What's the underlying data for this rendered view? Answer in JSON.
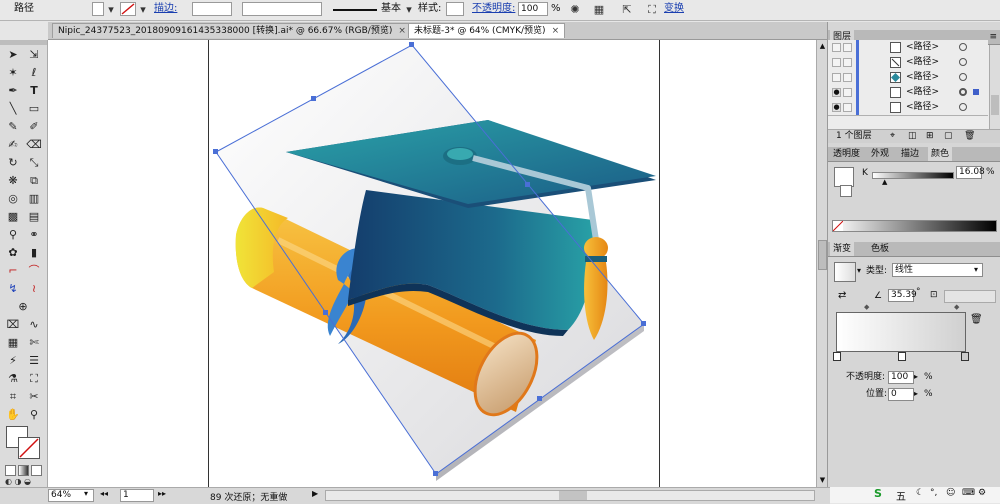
{
  "control_bar": {
    "object_type": "路径",
    "stroke_label": "描边:",
    "stroke_profile": "基本",
    "style_label": "样式:",
    "opacity_label": "不透明度:",
    "opacity_value": "100",
    "opacity_unit": "%",
    "transform_label": "变换"
  },
  "tabs": [
    {
      "label": "Nipic_24377523_20180909161435338000 [转换].ai* @ 66.67% (RGB/预览)",
      "close": "×"
    },
    {
      "label": "未标题-3* @ 64% (CMYK/预览)",
      "close": "×"
    }
  ],
  "layers_panel": {
    "title": "图层",
    "rows": [
      {
        "name": "<路径>"
      },
      {
        "name": "<路径>"
      },
      {
        "name": "<路径>"
      },
      {
        "name": "<路径>"
      },
      {
        "name": "<路径>"
      }
    ],
    "footer": "1 个图层"
  },
  "color_panel": {
    "tabs": [
      "透明度",
      "外观",
      "描边",
      "颜色"
    ],
    "channel": "K",
    "value": "16.08",
    "unit": "%"
  },
  "gradient_panel": {
    "tabs": [
      "渐变",
      "色板"
    ],
    "type_label": "类型:",
    "type_value": "线性",
    "angle_value": "35.39",
    "angle_unit": "°",
    "opacity_label": "不透明度:",
    "opacity_value": "100",
    "location_label": "位置:",
    "location_value": "0",
    "percent": "%"
  },
  "status_bar": {
    "zoom": "64%",
    "page": "1",
    "undo_text": "89 次还原；无重做"
  },
  "taskbar": {
    "ime": "五"
  },
  "colors": {
    "cap_top": "#2a8a9c",
    "cap_dark": "#17426b",
    "tassel": "#f0a51c",
    "scroll_orange": "#f29a1e",
    "ribbon_blue": "#3a84d0",
    "selection_blue": "#4a6fd6"
  }
}
